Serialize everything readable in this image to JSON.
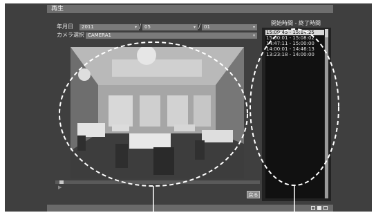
{
  "header": {
    "title": "再生"
  },
  "date": {
    "label": "年月日",
    "year": "2011",
    "month": "05",
    "day": "01",
    "separator": "/"
  },
  "camera": {
    "label": "カメラ選択",
    "value": "CAMERA1"
  },
  "recordings": {
    "header": "開始時間 - 終了時間",
    "items": [
      "15:09:45 - 15:14:25",
      "15:00:01 - 15:08:02",
      "14:47:11 - 15:00:00",
      "14:00:01 - 14:46:13",
      "13:23:18 - 14:00:00"
    ],
    "selected_index": 0
  },
  "playback": {
    "back_label": "戻る",
    "position": 0.02
  },
  "icons": {
    "dropdown": "chevron-down-icon",
    "play": "play-icon"
  },
  "colors": {
    "background": "#3f3f3f",
    "highlight": "#d8d8d8"
  }
}
